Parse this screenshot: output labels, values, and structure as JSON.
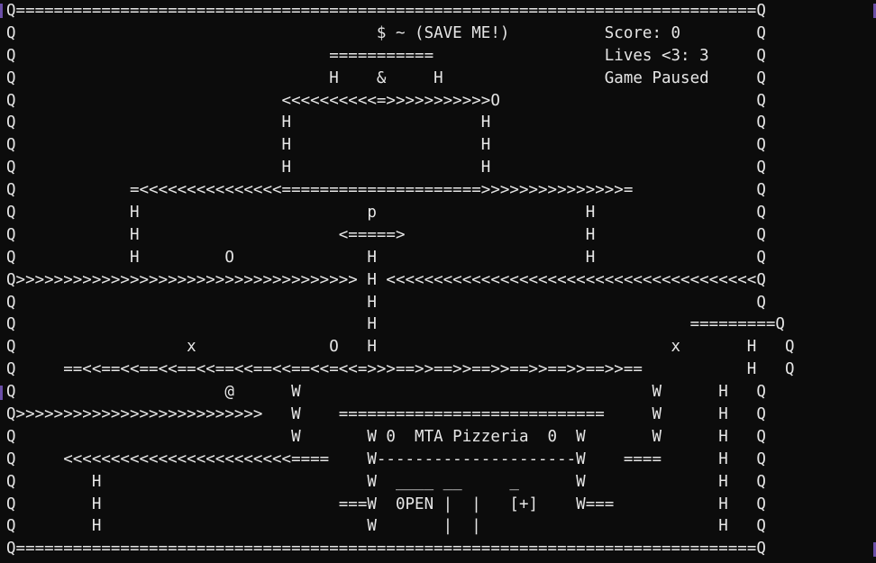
{
  "colors": {
    "background": "#0c0c0c",
    "text": "#e6e6e6",
    "gutter_marker": "#6b4fa8"
  },
  "game": {
    "title": "$ ~ (SAVE ME!)",
    "score_label": "Score: 0",
    "lives_label": "Lives <3: 3",
    "status_label": "Game Paused",
    "store_name": "MTA Pizzeria",
    "store_sign": "0PEN"
  },
  "screen_rows": [
    "Q==============================================================================Q",
    "Q                                      $ ~ (SAVE ME!)          Score: 0        Q",
    "Q                                 ===========                  Lives <3: 3     Q",
    "Q                                 H    &     H                 Game Paused     Q",
    "Q                            <<<<<<<<<<=>>>>>>>>>>>O                           Q",
    "Q                            H                    H                            Q",
    "Q                            H                    H                            Q",
    "Q                            H                    H                            Q",
    "Q            =<<<<<<<<<<<<<<<=====================>>>>>>>>>>>>>>>=             Q",
    "Q            H                        p                      H                 Q",
    "Q            H                     <=====>                   H                 Q",
    "Q            H         O              H                      H                 Q",
    "Q>>>>>>>>>>>>>>>>>>>>>>>>>>>>>>>>>>>> H <<<<<<<<<<<<<<<<<<<<<<<<<<<<<<<<<<<<<<<Q",
    "Q                                     H                                        Q",
    "Q                                     H                                 =========Q",
    "Q                  x              O   H                               x       H   Q",
    "Q     ==<<==<<==<<==<<==<<==<<==<<=<<=>>>==>>==>>==>>==>>==>>==>>==           H   Q",
    "Q                      @      W                                     W      H   Q",
    "Q>>>>>>>>>>>>>>>>>>>>>>>>>>   W    ============================     W      H   Q",
    "Q                             W       W 0  MTA Pizzeria  0  W       W      H   Q",
    "Q     <<<<<<<<<<<<<<<<<<<<<<<<====    W---------------------W    ====      H   Q",
    "Q        H                            W  ____ __     _      W              H   Q",
    "Q        H                         ===W  0PEN |  |   [+]    W===           H   Q",
    "Q        H                            W       |  |                         H   Q",
    "Q==============================================================================Q"
  ]
}
